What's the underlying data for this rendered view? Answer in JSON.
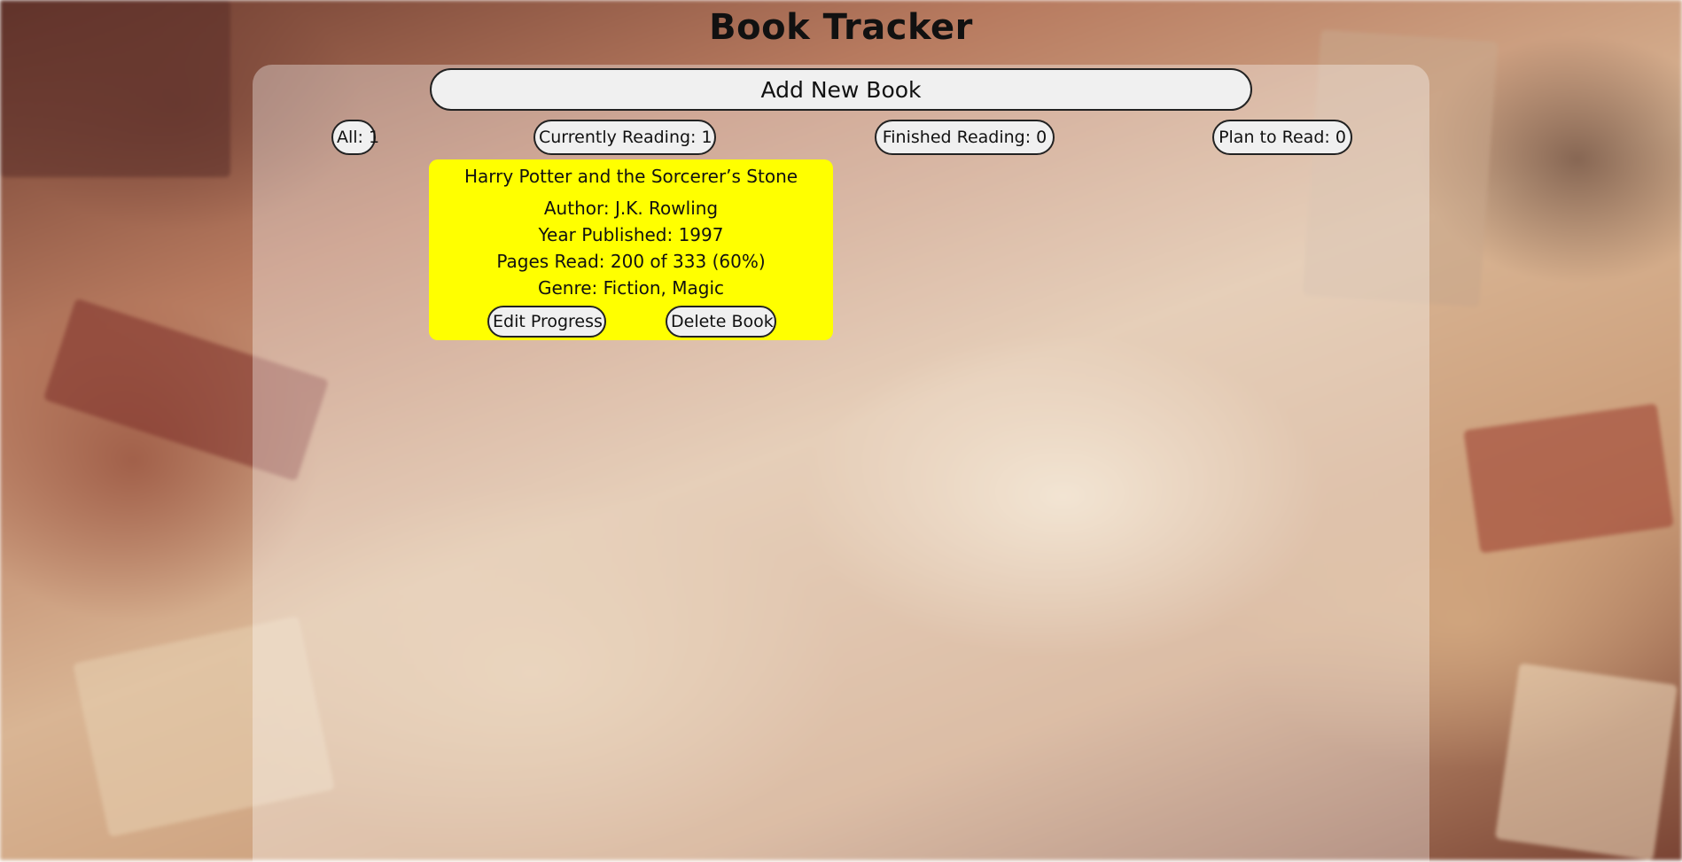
{
  "app": {
    "title": "Book Tracker",
    "background_image": "blurred-books-background"
  },
  "toolbar": {
    "add_label": "Add New Book"
  },
  "filters": [
    {
      "label": "All: 1"
    },
    {
      "label": "Currently Reading: 1"
    },
    {
      "label": "Finished Reading: 0"
    },
    {
      "label": "Plan to Read: 0"
    }
  ],
  "books": [
    {
      "title": "Harry Potter and the Sorcerer’s Stone",
      "author": "Author: J.K. Rowling",
      "year": "Year Published: 1997",
      "pages": "Pages Read: 200 of 333 (60%)",
      "genre": "Genre: Fiction, Magic",
      "edit_label": "Edit Progress",
      "delete_label": "Delete Book",
      "card_color": "#ffff00"
    }
  ],
  "colors": {
    "card": "#ffff00",
    "button_bg": "#f0f0f0",
    "button_border": "#222222",
    "text": "#111111"
  }
}
